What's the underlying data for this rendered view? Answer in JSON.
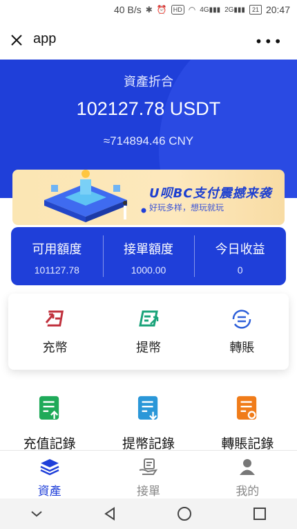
{
  "status_bar": {
    "speed": "40 B/s",
    "network_4g": "4G",
    "network_2g": "2G",
    "battery": "21",
    "time": "20:47"
  },
  "appbar": {
    "title": "app"
  },
  "hero": {
    "label": "資產折合",
    "amount": "102127.78 USDT",
    "cny": "≈714894.46 CNY"
  },
  "banner": {
    "title": "U呗BC支付震撼来袭",
    "subtitle": "好玩多样，想玩就玩"
  },
  "quota": [
    {
      "label": "可用額度",
      "value": "101127.78"
    },
    {
      "label": "接單額度",
      "value": "1000.00"
    },
    {
      "label": "今日收益",
      "value": "0"
    }
  ],
  "actions": [
    {
      "label": "充幣",
      "icon": "deposit-icon"
    },
    {
      "label": "提幣",
      "icon": "withdraw-icon"
    },
    {
      "label": "轉賬",
      "icon": "transfer-icon"
    }
  ],
  "records": [
    {
      "label": "充值記錄",
      "icon": "deposit-record-icon",
      "color": "#1faa59"
    },
    {
      "label": "提幣記錄",
      "icon": "withdraw-record-icon",
      "color": "#2a97d8"
    },
    {
      "label": "轉賬記錄",
      "icon": "transfer-record-icon",
      "color": "#f07c1a"
    }
  ],
  "bottom_nav": [
    {
      "label": "資產",
      "icon": "assets-icon",
      "active": true
    },
    {
      "label": "接單",
      "icon": "orders-icon",
      "active": false
    },
    {
      "label": "我的",
      "icon": "profile-icon",
      "active": false
    }
  ],
  "colors": {
    "primary": "#1f3fd9",
    "banner_bg": "#fbe6b3",
    "deposit": "#c0313d",
    "withdraw": "#1aa37a",
    "transfer": "#2d5fd9"
  }
}
